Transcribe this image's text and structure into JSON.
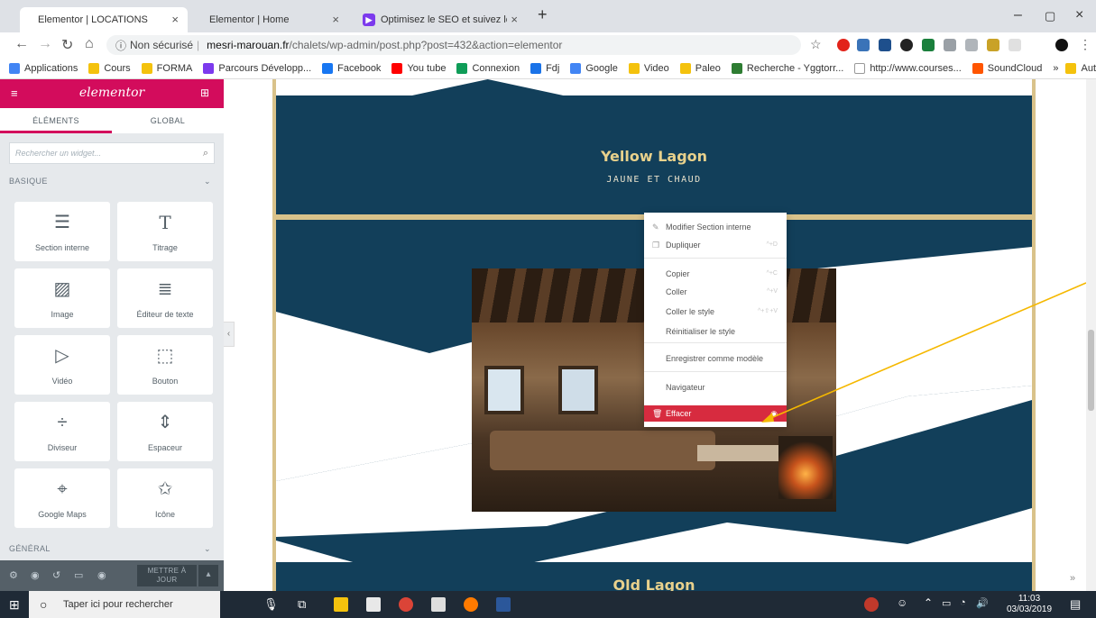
{
  "browser": {
    "tabs": [
      {
        "title": "Elementor | LOCATIONS"
      },
      {
        "title": "Elementor | Home"
      },
      {
        "title": "Optimisez le SEO et suivez le traf"
      }
    ],
    "security_label": "Non sécurisé",
    "url_host": "mesri-marouan.fr",
    "url_path": "/chalets/wp-admin/post.php?post=432&action=elementor",
    "bookmarks": [
      {
        "label": "Applications",
        "color": "#4285f4"
      },
      {
        "label": "Cours",
        "color": "#f4c20d"
      },
      {
        "label": "FORMA",
        "color": "#f4c20d"
      },
      {
        "label": "Parcours Développ...",
        "color": "#7c3aed"
      },
      {
        "label": "Facebook",
        "color": "#1877f2"
      },
      {
        "label": "You tube",
        "color": "#ff0000"
      },
      {
        "label": "Connexion",
        "color": "#0f9d58"
      },
      {
        "label": "Fdj",
        "color": "#1a73e8"
      },
      {
        "label": "Google",
        "color": "#4285f4"
      },
      {
        "label": "Video",
        "color": "#f4c20d"
      },
      {
        "label": "Paleo",
        "color": "#f4c20d"
      },
      {
        "label": "Recherche - Yggtorr...",
        "color": "#2e7d32"
      },
      {
        "label": "http://www.courses...",
        "color": "#ffffff"
      },
      {
        "label": "SoundCloud",
        "color": "#ff5500"
      }
    ],
    "more_bookmarks": "»",
    "other_bookmarks": "Autres favoris"
  },
  "panel": {
    "logo": "elementor",
    "tabs": [
      "ÉLÉMENTS",
      "GLOBAL"
    ],
    "search_placeholder": "Rechercher un widget...",
    "section_basic": "BASIQUE",
    "section_general": "GÉNÉRAL",
    "widgets": [
      {
        "label": "Section interne",
        "icon": "columns-icon"
      },
      {
        "label": "Titrage",
        "icon": "heading-icon"
      },
      {
        "label": "Image",
        "icon": "image-icon"
      },
      {
        "label": "Éditeur de texte",
        "icon": "text-editor-icon"
      },
      {
        "label": "Vidéo",
        "icon": "video-icon"
      },
      {
        "label": "Bouton",
        "icon": "button-icon"
      },
      {
        "label": "Diviseur",
        "icon": "divider-icon"
      },
      {
        "label": "Espaceur",
        "icon": "spacer-icon"
      },
      {
        "label": "Google Maps",
        "icon": "map-icon"
      },
      {
        "label": "Icône",
        "icon": "star-icon"
      }
    ],
    "update_label": "METTRE À JOUR"
  },
  "canvas": {
    "section1_title": "Yellow Lagon",
    "section1_subtitle": "JAUNE ET CHAUD",
    "section3_title": "Old Lagon"
  },
  "context_menu": {
    "items": [
      {
        "label": "Modifier Section interne",
        "shortcut": ""
      },
      {
        "label": "Dupliquer",
        "shortcut": "^+D"
      },
      {
        "label": "Copier",
        "shortcut": "^+C"
      },
      {
        "label": "Coller",
        "shortcut": "^+V"
      },
      {
        "label": "Coller le style",
        "shortcut": "^+⇧+V"
      },
      {
        "label": "Réinitialiser le style",
        "shortcut": ""
      },
      {
        "label": "Enregistrer comme modèle",
        "shortcut": ""
      },
      {
        "label": "Navigateur",
        "shortcut": ""
      },
      {
        "label": "Effacer",
        "shortcut": ""
      }
    ]
  },
  "taskbar": {
    "search_placeholder": "Taper ici pour rechercher",
    "time": "11:03",
    "date": "03/03/2019"
  },
  "colors": {
    "elementor_pink": "#d30c5c",
    "navy": "#123f5a",
    "gold": "#d9c28a",
    "delete_red": "#d72b3f",
    "arrow": "#f5b800"
  }
}
